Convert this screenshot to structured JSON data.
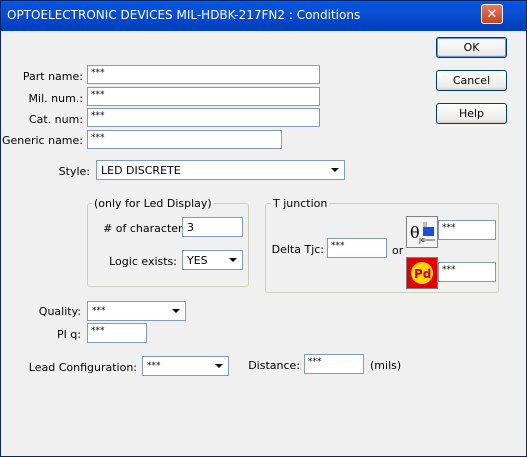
{
  "window": {
    "title": "OPTOELECTRONIC DEVICES  MIL-HDBK-217FN2 : Conditions",
    "close_glyph": "✕"
  },
  "buttons": {
    "ok": "OK",
    "cancel": "Cancel",
    "help": "Help"
  },
  "part": {
    "part_name_label": "Part name:",
    "part_name_value": "***",
    "mil_num_label": "Mil. num.:",
    "mil_num_value": "***",
    "cat_num_label": "Cat. num:",
    "cat_num_value": "***",
    "generic_name_label": "Generic name:",
    "generic_name_value": "***"
  },
  "style": {
    "label": "Style:",
    "value": "LED DISCRETE"
  },
  "led_display": {
    "group_label": "(only for Led Display)",
    "chars_label": "# of characters:",
    "chars_value": "3",
    "logic_label": "Logic exists:",
    "logic_value": "YES"
  },
  "tjunction": {
    "group_label": "T junction",
    "delta_label": "Delta Tjc:",
    "delta_value": "***",
    "or_label": "or",
    "theta_value": "***",
    "pd_value": "***",
    "theta_icon_text": "θjc",
    "pd_icon_text": "Pd"
  },
  "quality": {
    "label": "Quality:",
    "value": "***"
  },
  "piq": {
    "label": "PI q:",
    "value": "***"
  },
  "lead": {
    "label": "Lead Configuration:",
    "value": "***",
    "distance_label": "Distance:",
    "distance_value": "***",
    "units": "(mils)"
  },
  "icons": [
    "close-icon",
    "chevron-down-icon",
    "theta-jc-icon",
    "pd-icon"
  ],
  "colors": {
    "titlebar": "#0054e3",
    "window_bg": "#f0f0f0",
    "pd_icon_bg": "#e00000",
    "pd_icon_fg": "#ffd800"
  }
}
